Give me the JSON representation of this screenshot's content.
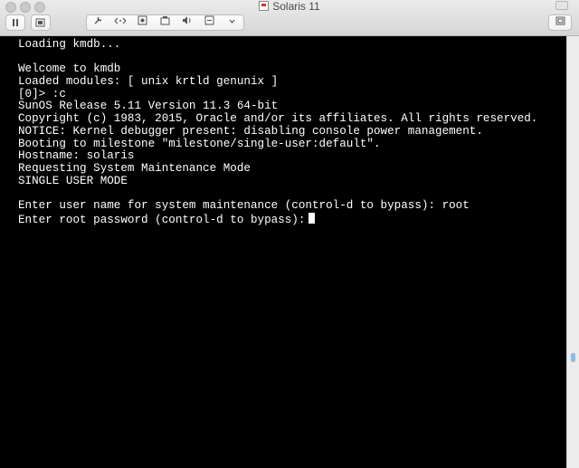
{
  "window": {
    "title": "Solaris 11"
  },
  "toolbar": {
    "pause_icon": "pause-icon",
    "snapshot_icon": "snapshot-icon",
    "group_icons": [
      "wrench-icon",
      "network-arrows-icon",
      "disk-icon",
      "hdd-icon",
      "speaker-icon",
      "usb-icon",
      "chevron-icon"
    ],
    "fullscreen_icon": "fullscreen-icon"
  },
  "console": {
    "lines": [
      "Loading kmdb...",
      "",
      "Welcome to kmdb",
      "Loaded modules: [ unix krtld genunix ]",
      "[0]> :c",
      "SunOS Release 5.11 Version 11.3 64-bit",
      "Copyright (c) 1983, 2015, Oracle and/or its affiliates. All rights reserved.",
      "NOTICE: Kernel debugger present: disabling console power management.",
      "Booting to milestone \"milestone/single-user:default\".",
      "Hostname: solaris",
      "Requesting System Maintenance Mode",
      "SINGLE USER MODE",
      "",
      "Enter user name for system maintenance (control-d to bypass): root"
    ],
    "prompt": "Enter root password (control-d to bypass):"
  }
}
